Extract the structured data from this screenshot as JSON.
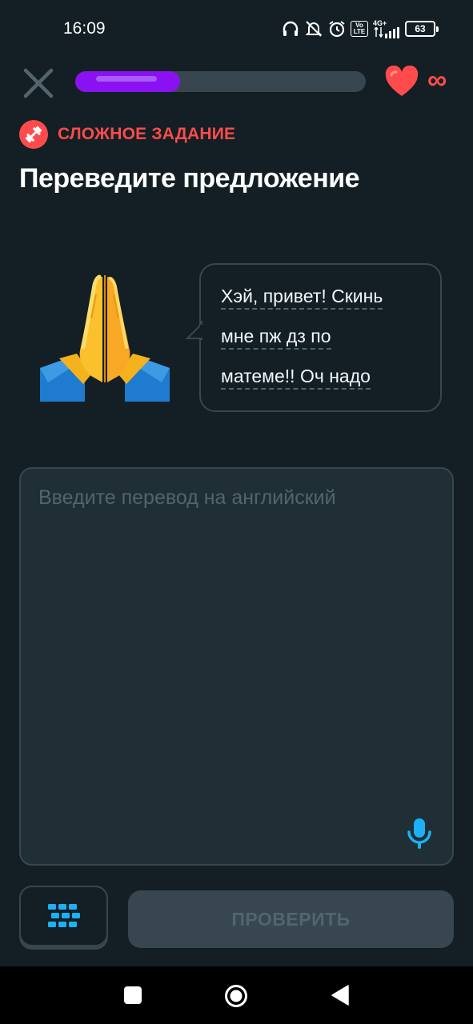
{
  "status_bar": {
    "time": "16:09",
    "network": "4G+",
    "lte_badge": "Vo LTE",
    "battery": "63",
    "icons": [
      "headphones-icon",
      "mute-icon",
      "alarm-icon",
      "lte-icon",
      "signal-icon",
      "battery-icon"
    ]
  },
  "top_bar": {
    "close_icon": "close-icon",
    "progress": 0.36,
    "hearts_icon": "heart-icon",
    "hearts_value": "∞"
  },
  "challenge": {
    "icon": "dumbbell-icon",
    "label": "СЛОЖНОЕ ЗАДАНИЕ"
  },
  "title": "Переведите предложение",
  "prompt": {
    "character_icon": "praying-hands-emoji",
    "lines": [
      "Хэй, привет! Скинь",
      "мне пж дз по",
      "матеме!! Оч надо"
    ]
  },
  "answer": {
    "placeholder": "Введите перевод на английский",
    "value": "",
    "mic_icon": "microphone-icon"
  },
  "actions": {
    "keyboard_icon": "keyboard-icon",
    "check_label": "ПРОВЕРИТЬ"
  },
  "nav": {
    "recents": "square-icon",
    "home": "circle-icon",
    "back": "back-triangle-icon"
  },
  "colors": {
    "background": "#131f24",
    "border": "#37464f",
    "accent_purple": "#8a12f2",
    "danger": "#ff4b4b",
    "mic_blue": "#1cb0f6",
    "muted_text": "#52656d"
  }
}
